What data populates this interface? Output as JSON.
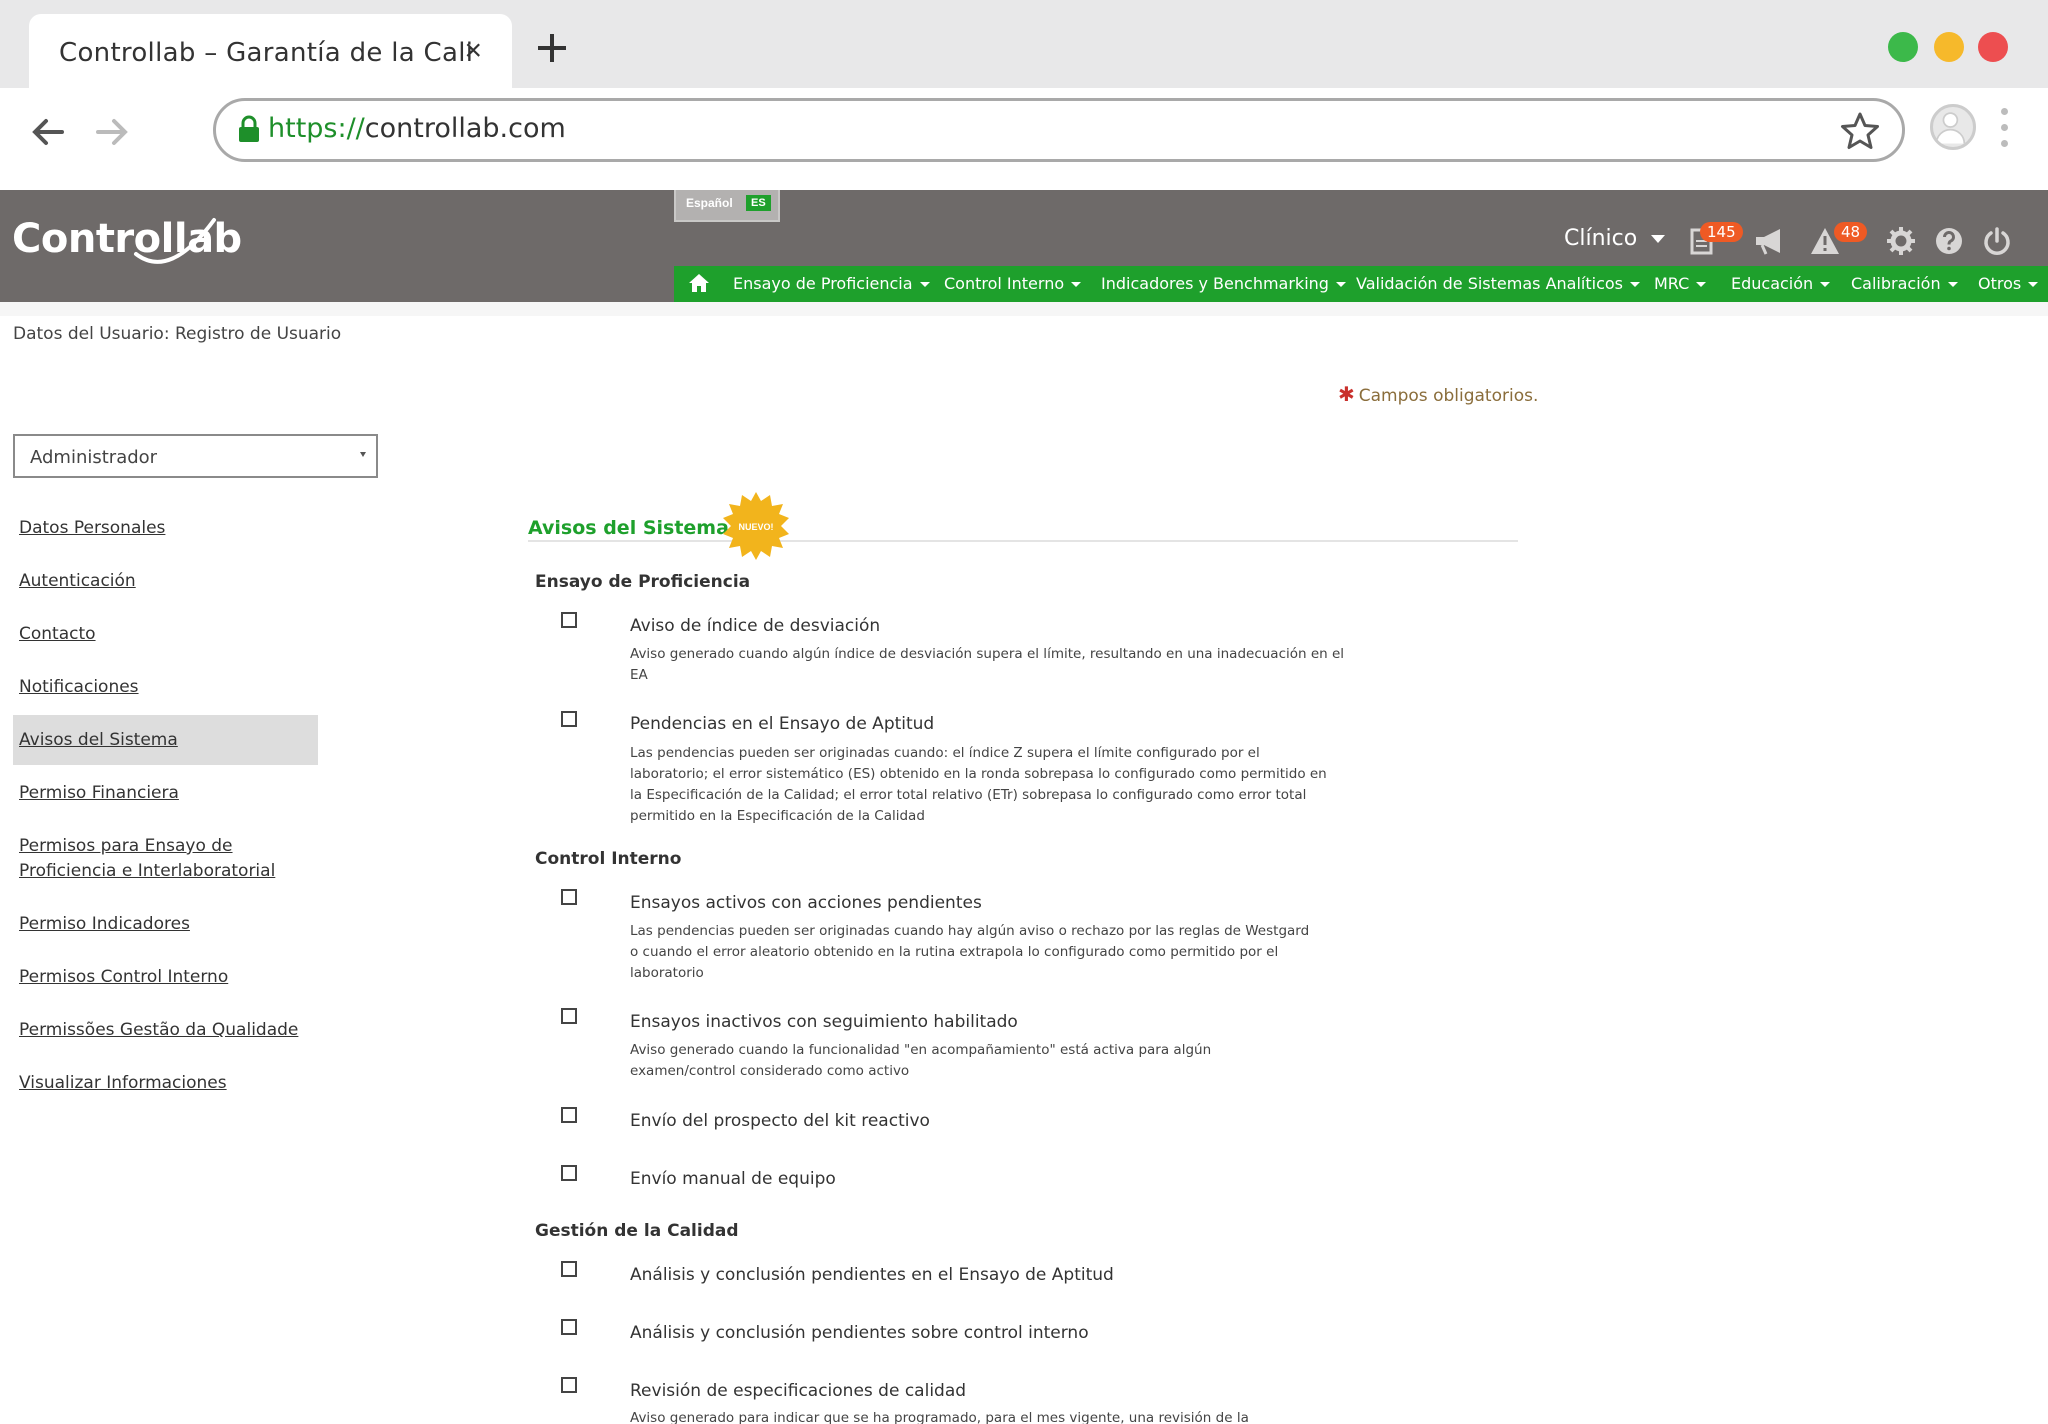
{
  "browser": {
    "tab_title": "Controllab – Garantía de la Cali",
    "tab_close": "×",
    "url_scheme": "https://",
    "url_host": "controllab.com",
    "window_dots": [
      "#3cb94a",
      "#f6b92b",
      "#ed4e50"
    ]
  },
  "header": {
    "logo": "Controllab",
    "language_label": "Español",
    "language_code": "ES",
    "area_label": "Clínico",
    "badge_documents": "145",
    "badge_alerts": "48",
    "accent_color": "#1ea02c",
    "header_color": "#6e6a69"
  },
  "mainnav": {
    "items": [
      "Ensayo de Proficiencia",
      "Control Interno",
      "Indicadores y Benchmarking",
      "Validación de Sistemas Analíticos",
      "MRC",
      "Educación",
      "Calibración",
      "Otros"
    ]
  },
  "page": {
    "breadcrumb": "Datos del Usuario: Registro de Usuario",
    "required_note": "Campos obligatorios.",
    "required_mark": "✱",
    "role_value": "Administrador"
  },
  "sidenav": {
    "items": [
      "Datos Personales",
      "Autenticación",
      "Contacto",
      "Notificaciones",
      "Avisos del Sistema",
      "Permiso Financiera",
      "Permisos para Ensayo de Proficiencia e Interlaboratorial",
      "Permiso Indicadores",
      "Permisos Control Interno",
      "Permissões Gestão da Qualidade",
      "Visualizar Informaciones"
    ],
    "active": "Avisos del Sistema"
  },
  "section": {
    "title": "Avisos del Sistema",
    "new_badge": "NUEVO!"
  },
  "groups": [
    {
      "title": "Ensayo de Proficiencia",
      "options": [
        {
          "label": "Aviso de índice de desviación",
          "desc": "Aviso generado cuando algún índice de desviación supera el límite, resultando en una inadecuación en el EA"
        },
        {
          "label": "Pendencias en el Ensayo de Aptitud",
          "desc": "Las pendencias pueden ser originadas cuando: el índice Z supera el límite configurado por el laboratorio; el error sistemático (ES) obtenido en la ronda sobrepasa lo configurado como permitido en la Especificación de la Calidad; el error total relativo (ETr) sobrepasa lo configurado como error total permitido en la Especificación de la Calidad"
        }
      ]
    },
    {
      "title": "Control Interno",
      "options": [
        {
          "label": "Ensayos activos con acciones pendientes",
          "desc": "Las pendencias pueden ser originadas cuando hay algún aviso o rechazo por las reglas de Westgard o cuando el error aleatorio obtenido en la rutina extrapola lo configurado como permitido por el laboratorio"
        },
        {
          "label": "Ensayos inactivos con seguimiento habilitado",
          "desc": "Aviso generado cuando la funcionalidad \"en acompañamiento\" está activa para algún examen/control considerado como activo"
        },
        {
          "label": "Envío del prospecto del kit reactivo",
          "desc": ""
        },
        {
          "label": "Envío manual de equipo",
          "desc": ""
        }
      ]
    },
    {
      "title": "Gestión de la Calidad",
      "options": [
        {
          "label": "Análisis y conclusión pendientes en el Ensayo de Aptitud",
          "desc": ""
        },
        {
          "label": "Análisis y conclusión pendientes sobre control interno",
          "desc": ""
        },
        {
          "label": "Revisión de especificaciones de calidad",
          "desc": "Aviso generado para indicar que se ha programado, para el mes vigente, una revisión de la"
        }
      ]
    }
  ]
}
